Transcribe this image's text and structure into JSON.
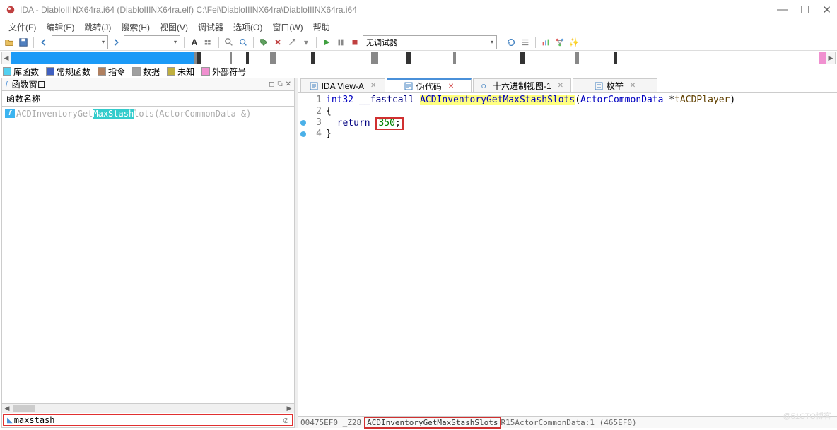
{
  "titlebar": {
    "text": "IDA - DiabloIIINX64ra.i64 (DiabloIIINX64ra.elf) C:\\Fei\\DiabloIIINX64ra\\DiabloIIINX64ra.i64"
  },
  "menu": {
    "file": "文件(F)",
    "edit": "编辑(E)",
    "jump": "跳转(J)",
    "search": "搜索(H)",
    "view": "视图(V)",
    "debugger": "调试器",
    "options": "选项(O)",
    "window": "窗口(W)",
    "help": "帮助"
  },
  "toolbar": {
    "debugger_dd": "无调试器"
  },
  "legend": {
    "lib": "库函数",
    "reg": "常规函数",
    "ins": "指令",
    "data": "数据",
    "unk": "未知",
    "ext": "外部符号"
  },
  "left": {
    "panel_title": "函数窗口",
    "header": "函数名称",
    "func": {
      "pre": "ACDInventoryGet",
      "hl": "MaxStash",
      "post": "lots(ActorCommonData &)"
    },
    "search_value": "maxstash"
  },
  "tabs": {
    "idaview": "IDA View-A",
    "pseudo": "伪代码",
    "hex": "十六进制视图-1",
    "enum": "枚举"
  },
  "code": {
    "l1_type": "int32",
    "l1_cc": " __fastcall ",
    "l1_fn": "ACDInventoryGetMaxStashSlots",
    "l1_po": "(",
    "l1_pt": "ActorCommonData ",
    "l1_star": "*",
    "l1_pn": "tACDPlayer",
    "l1_pc": ")",
    "l2": "{",
    "l3_ret": "return",
    "l3_num": "350",
    "l3_semi": ";",
    "l4": "}"
  },
  "status": {
    "addr": "00475EF0 _Z28",
    "sym": "ACDInventoryGetMaxStashSlots",
    "rest": "R15ActorCommonData:1 (465EF0)"
  },
  "watermark": "@51CTO博客"
}
